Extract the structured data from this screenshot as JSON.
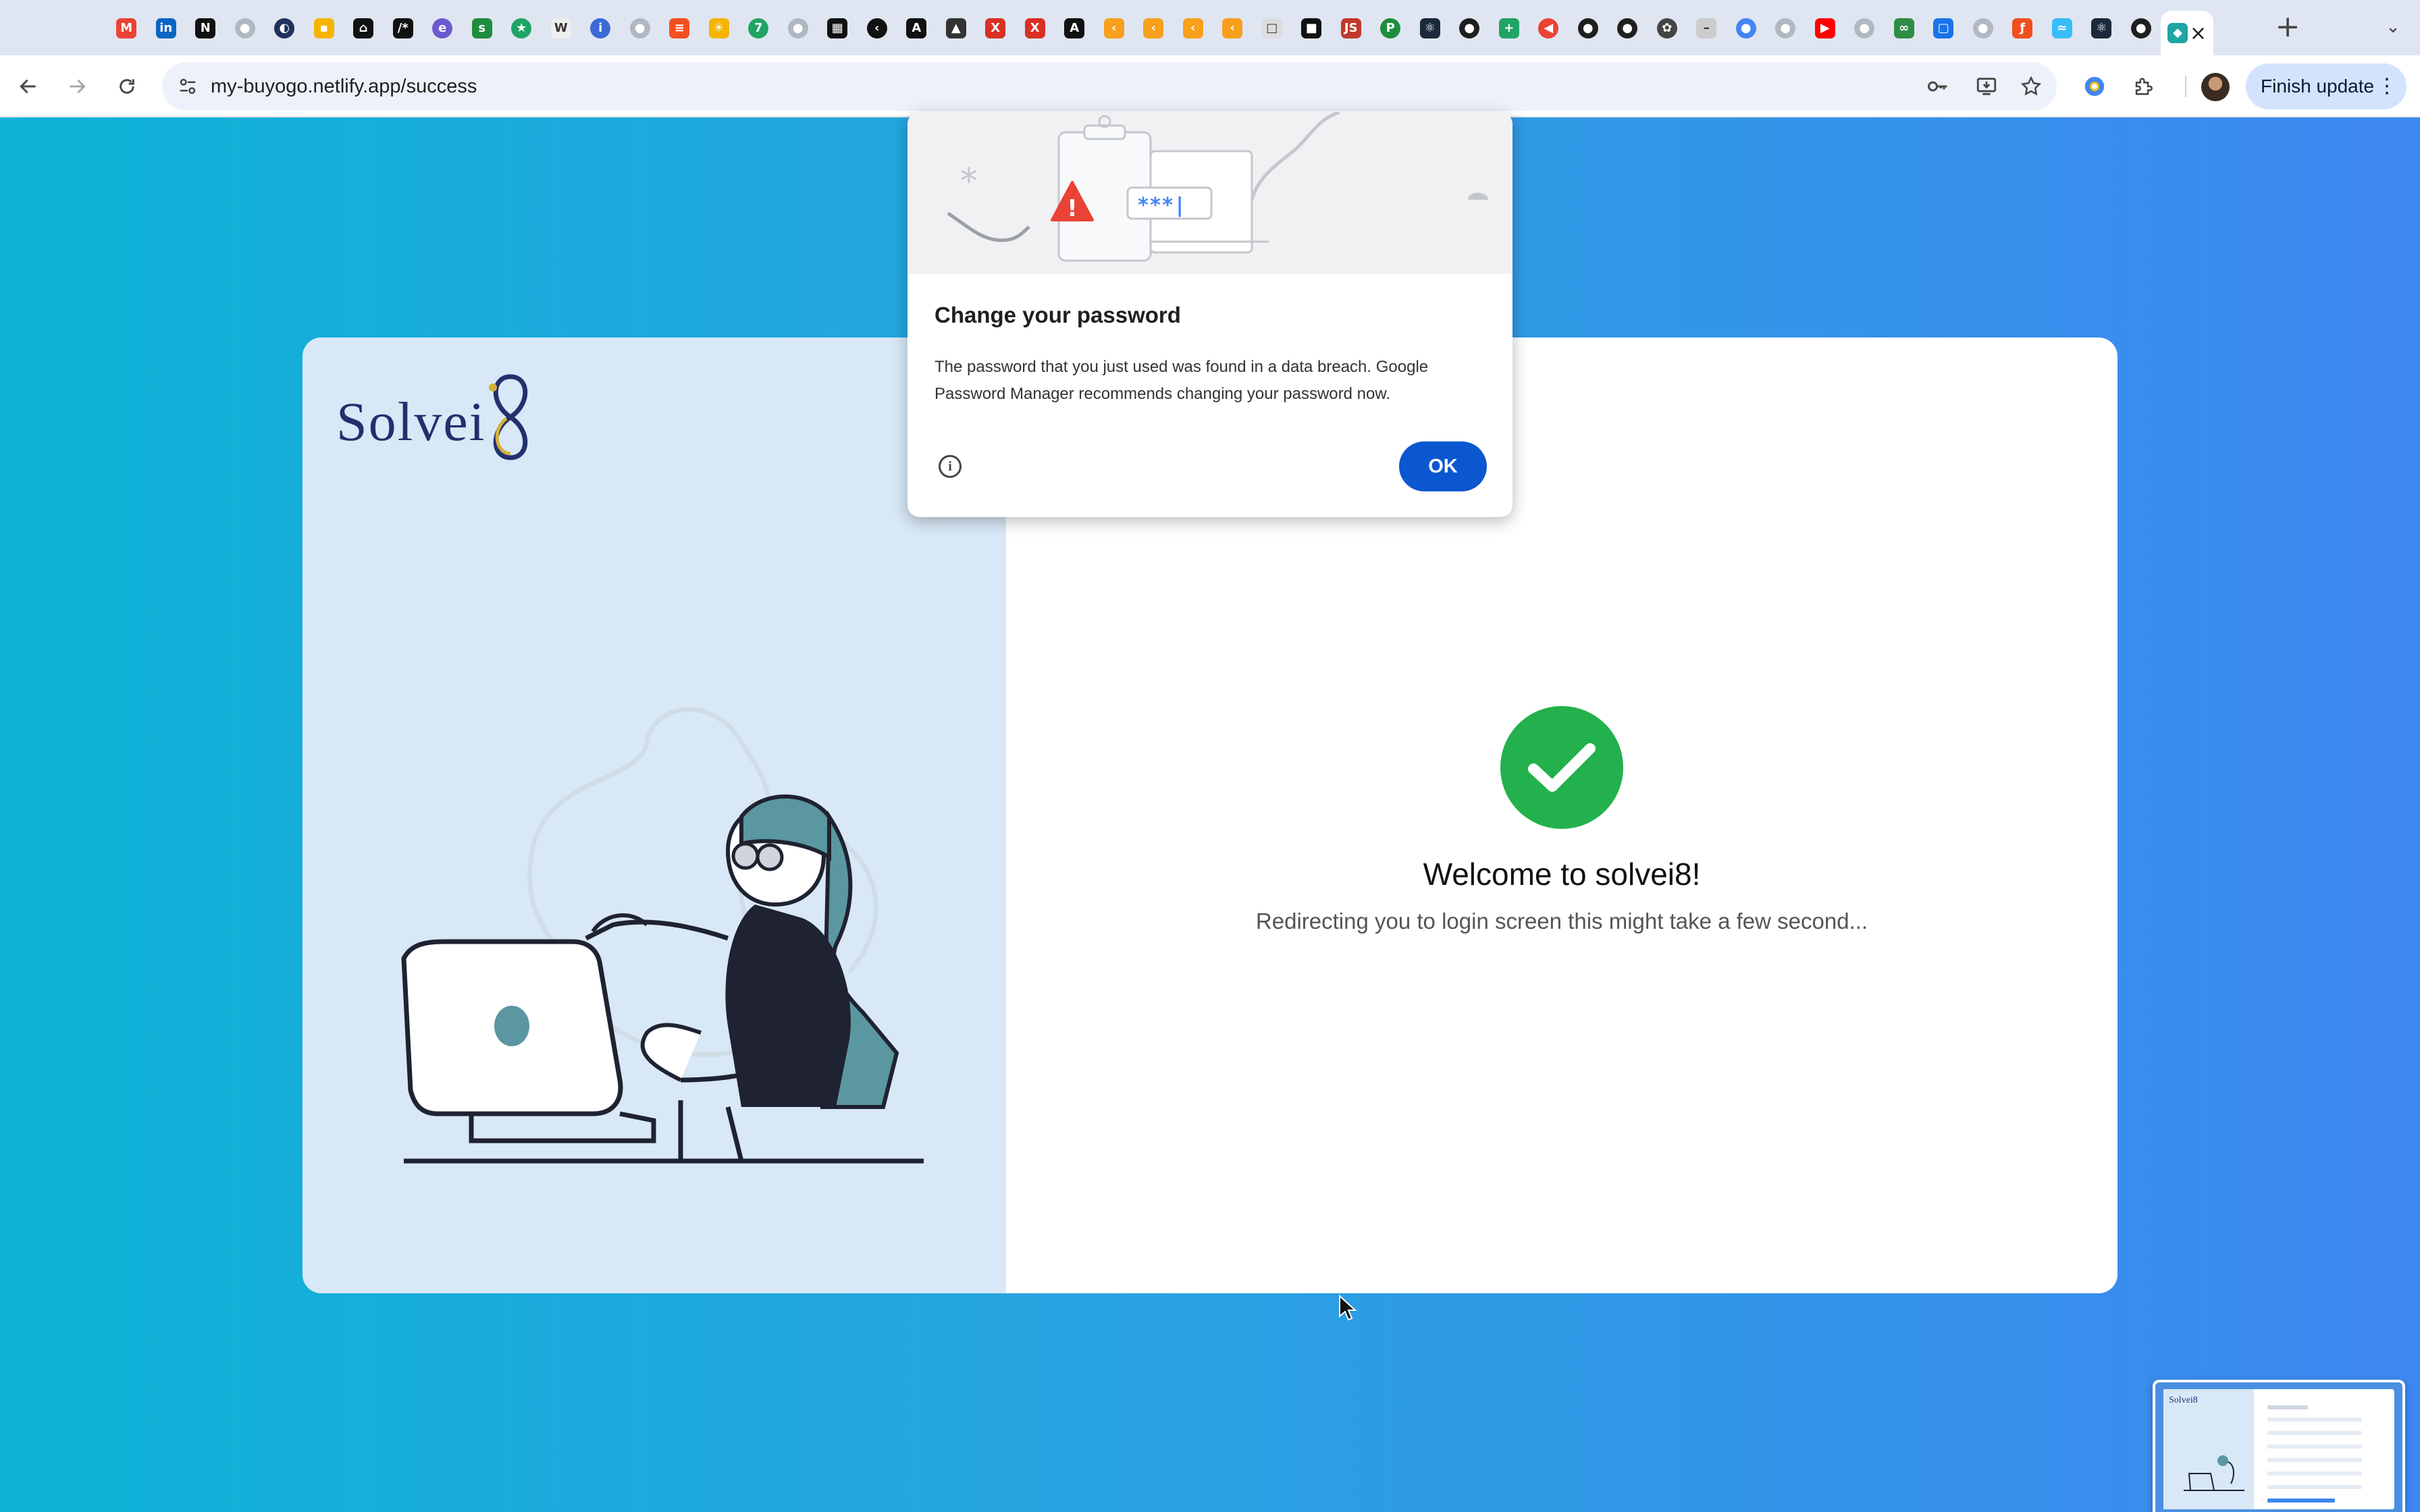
{
  "browser": {
    "tabs": [
      {
        "icon": "gmail-icon",
        "color": "#ea4335",
        "glyph": "M"
      },
      {
        "icon": "linkedin-icon",
        "color": "#0a66c2",
        "glyph": "in"
      },
      {
        "icon": "notion-icon",
        "color": "#111111",
        "glyph": "N"
      },
      {
        "icon": "github-icon",
        "color": "#b0b8c2",
        "glyph": "●",
        "round": true
      },
      {
        "icon": "globe-icon",
        "color": "#20305f",
        "glyph": "◐",
        "round": true
      },
      {
        "icon": "keep-icon",
        "color": "#f6b400",
        "glyph": "▪"
      },
      {
        "icon": "bookmark-icon",
        "color": "#111111",
        "glyph": "⌂"
      },
      {
        "icon": "regex-icon",
        "color": "#111111",
        "glyph": "/*"
      },
      {
        "icon": "elementor-icon",
        "color": "#6a5acd",
        "glyph": "e",
        "round": true
      },
      {
        "icon": "sheets-icon",
        "color": "#1e8e3e",
        "glyph": "s"
      },
      {
        "icon": "star-icon",
        "color": "#20a464",
        "glyph": "★",
        "round": true
      },
      {
        "icon": "wiki-icon",
        "color": "#eeeeee",
        "glyph": "W"
      },
      {
        "icon": "info-icon",
        "color": "#3c6ad4",
        "glyph": "i",
        "round": true
      },
      {
        "icon": "github-icon",
        "color": "#b0b8c2",
        "glyph": "●",
        "round": true
      },
      {
        "icon": "stack-icon",
        "color": "#f25022",
        "glyph": "≡"
      },
      {
        "icon": "bulb-icon",
        "color": "#f4b400",
        "glyph": "☀"
      },
      {
        "icon": "seven-icon",
        "color": "#20a464",
        "glyph": "7",
        "round": true
      },
      {
        "icon": "globe-icon",
        "color": "#b0b8c2",
        "glyph": "●",
        "round": true
      },
      {
        "icon": "grid-icon",
        "color": "#111111",
        "glyph": "▦"
      },
      {
        "icon": "arrow-icon",
        "color": "#111111",
        "glyph": "‹",
        "round": true
      },
      {
        "icon": "angular-icon",
        "color": "#111111",
        "glyph": "A"
      },
      {
        "icon": "cap-icon",
        "color": "#333333",
        "glyph": "▲"
      },
      {
        "icon": "figure-icon",
        "color": "#d93025",
        "glyph": "X"
      },
      {
        "icon": "figure-icon",
        "color": "#d93025",
        "glyph": "X"
      },
      {
        "icon": "angular-icon",
        "color": "#111111",
        "glyph": "A"
      },
      {
        "icon": "leetcode-icon",
        "color": "#f89f1b",
        "glyph": "‹"
      },
      {
        "icon": "leetcode-icon",
        "color": "#f89f1b",
        "glyph": "‹"
      },
      {
        "icon": "leetcode-icon",
        "color": "#f89f1b",
        "glyph": "‹"
      },
      {
        "icon": "leetcode-icon",
        "color": "#f89f1b",
        "glyph": "‹"
      },
      {
        "icon": "blank-icon",
        "color": "#dddddd",
        "glyph": "□"
      },
      {
        "icon": "square-icon",
        "color": "#111111",
        "glyph": "■"
      },
      {
        "icon": "js-icon",
        "color": "#c0392b",
        "glyph": "JS"
      },
      {
        "icon": "p-icon",
        "color": "#1e8e3e",
        "glyph": "P",
        "round": true
      },
      {
        "icon": "react-icon",
        "color": "#1b2a3a",
        "glyph": "⚛"
      },
      {
        "icon": "github-icon",
        "color": "#1f1f1f",
        "glyph": "●",
        "round": true
      },
      {
        "icon": "plus-icon",
        "color": "#20a464",
        "glyph": "+"
      },
      {
        "icon": "red-circle-icon",
        "color": "#ea4335",
        "glyph": "◀",
        "round": true
      },
      {
        "icon": "github-icon",
        "color": "#1f1f1f",
        "glyph": "●",
        "round": true
      },
      {
        "icon": "github-icon",
        "color": "#1f1f1f",
        "glyph": "●",
        "round": true
      },
      {
        "icon": "openai-icon",
        "color": "#444444",
        "glyph": "✿",
        "round": true
      },
      {
        "icon": "page-icon",
        "color": "#cccccc",
        "glyph": "–"
      },
      {
        "icon": "badge-icon",
        "color": "#4285f4",
        "glyph": "●",
        "round": true
      },
      {
        "icon": "globe-icon",
        "color": "#b0b8c2",
        "glyph": "●",
        "round": true
      },
      {
        "icon": "youtube-icon",
        "color": "#ff0000",
        "glyph": "▶"
      },
      {
        "icon": "github-icon",
        "color": "#b0b8c2",
        "glyph": "●",
        "round": true
      },
      {
        "icon": "geeks-icon",
        "color": "#2f8d46",
        "glyph": "∞"
      },
      {
        "icon": "chat-icon",
        "color": "#1a73e8",
        "glyph": "▢"
      },
      {
        "icon": "globe-icon",
        "color": "#b0b8c2",
        "glyph": "●",
        "round": true
      },
      {
        "icon": "figma-icon",
        "color": "#f24e1e",
        "glyph": "ƒ"
      },
      {
        "icon": "tailwind-icon",
        "color": "#38bdf8",
        "glyph": "≈"
      },
      {
        "icon": "react-icon",
        "color": "#1b2a3a",
        "glyph": "⚛"
      },
      {
        "icon": "github-icon",
        "color": "#1f1f1f",
        "glyph": "●",
        "round": true
      },
      {
        "icon": "netlify-icon",
        "color": "#20a4a4",
        "glyph": "◆"
      }
    ],
    "new_tab_glyph": "+",
    "tab_search_glyph": "⌄",
    "url": "my-buyogo.netlify.app/success",
    "finish_update_label": "Finish update",
    "menu_glyph": "⋮"
  },
  "page": {
    "logo_text": "Solvei",
    "welcome": "Welcome to solvei8!",
    "redirect": "Redirecting you to login screen this might take a few second..."
  },
  "dialog": {
    "art_masked_text": "***|",
    "title": "Change your password",
    "body": "The password that you just used was found in a data breach. Google Password Manager recommends changing your password now.",
    "ok_label": "OK"
  },
  "colors": {
    "accent_blue": "#0b57d0",
    "success_green": "#22b14c",
    "page_gradient_start": "#0db3d6",
    "page_gradient_end": "#3d87f0"
  }
}
